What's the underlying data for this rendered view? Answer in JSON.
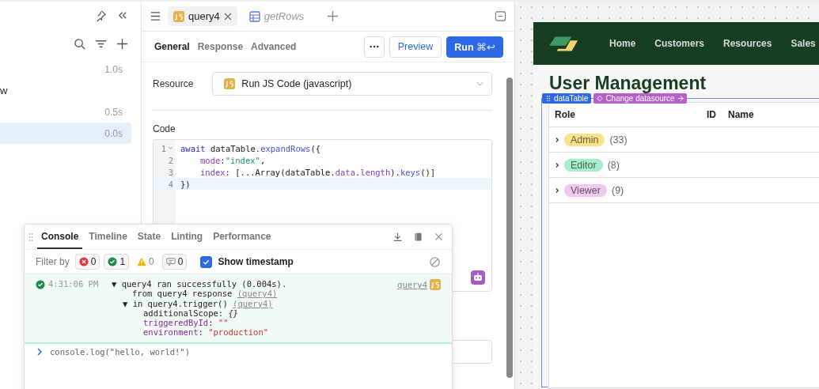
{
  "sidebar": {
    "items": [
      {
        "time": "1.0s",
        "selected": false
      },
      {
        "label": "w",
        "selected": false
      },
      {
        "time": "0.5s",
        "selected": false
      },
      {
        "time": "0.0s",
        "selected": true
      }
    ]
  },
  "editor_tabs": [
    {
      "label": "query4",
      "kind": "js",
      "selected": true,
      "preview": false
    },
    {
      "label": "getRows",
      "kind": "table",
      "selected": false,
      "preview": true
    }
  ],
  "query_tabs": [
    {
      "label": "General",
      "selected": true
    },
    {
      "label": "Response",
      "selected": false
    },
    {
      "label": "Advanced",
      "selected": false
    }
  ],
  "buttons": {
    "preview": "Preview",
    "run": "Run",
    "run_shortcut": "⌘↩"
  },
  "resource": {
    "label": "Resource",
    "value": "Run JS Code (javascript)"
  },
  "code": {
    "label": "Code",
    "lines": [
      {
        "number": "1",
        "foldable": true,
        "highlighted": false,
        "indented": false,
        "tokens": [
          {
            "kind": "keyword",
            "text": "await"
          },
          {
            "kind": "plain",
            "text": " dataTable."
          },
          {
            "kind": "method",
            "text": "expandRows"
          },
          {
            "kind": "plain",
            "text": "({"
          }
        ]
      },
      {
        "number": "2",
        "foldable": false,
        "highlighted": false,
        "indented": true,
        "tokens": [
          {
            "kind": "prop",
            "text": "mode"
          },
          {
            "kind": "plain",
            "text": ":"
          },
          {
            "kind": "string",
            "text": "\"index\""
          },
          {
            "kind": "plain",
            "text": ","
          }
        ]
      },
      {
        "number": "3",
        "foldable": false,
        "highlighted": false,
        "indented": true,
        "tokens": [
          {
            "kind": "prop",
            "text": "index"
          },
          {
            "kind": "plain",
            "text": ": [...Array(dataTable."
          },
          {
            "kind": "prop",
            "text": "data"
          },
          {
            "kind": "plain",
            "text": "."
          },
          {
            "kind": "prop",
            "text": "length"
          },
          {
            "kind": "plain",
            "text": ")."
          },
          {
            "kind": "method",
            "text": "keys"
          },
          {
            "kind": "plain",
            "text": "()]"
          }
        ]
      },
      {
        "number": "4",
        "foldable": false,
        "highlighted": true,
        "indented": false,
        "tokens": [
          {
            "kind": "plain",
            "text": "})"
          }
        ]
      }
    ]
  },
  "console": {
    "tabs": [
      {
        "label": "Console",
        "selected": true
      },
      {
        "label": "Timeline",
        "selected": false
      },
      {
        "label": "State",
        "selected": false
      },
      {
        "label": "Linting",
        "selected": false
      },
      {
        "label": "Performance",
        "selected": false
      }
    ],
    "filter": {
      "label": "Filter by",
      "chips": [
        {
          "kind": "error",
          "count": "0"
        },
        {
          "kind": "success",
          "count": "1"
        },
        {
          "kind": "warning",
          "count": "0"
        },
        {
          "kind": "message",
          "count": "0"
        }
      ]
    },
    "show_timestamp": {
      "label": "Show timestamp",
      "checked": true
    },
    "entries": [
      {
        "time": "4:31:06 PM",
        "source": "query4",
        "lines": [
          {
            "segments": [
              {
                "kind": "text",
                "text": "▼ query4 ran successfully (0.004s)."
              }
            ],
            "children": [
              {
                "segments": [
                  {
                    "kind": "text",
                    "text": "from query4 response "
                  },
                  {
                    "kind": "link",
                    "text": "(query4)"
                  }
                ]
              },
              {
                "segments": [
                  {
                    "kind": "text",
                    "text": "▼ in query4.trigger() "
                  },
                  {
                    "kind": "link",
                    "text": "(query4)"
                  }
                ],
                "children": [
                  {
                    "segments": [
                      {
                        "kind": "text",
                        "text": "additionalScope: "
                      },
                      {
                        "kind": "italic",
                        "text": "{}"
                      }
                    ]
                  },
                  {
                    "segments": [
                      {
                        "kind": "key",
                        "text": "triggeredById"
                      },
                      {
                        "kind": "text",
                        "text": ": "
                      },
                      {
                        "kind": "string",
                        "text": "\"\""
                      }
                    ]
                  },
                  {
                    "segments": [
                      {
                        "kind": "key",
                        "text": "environment"
                      },
                      {
                        "kind": "text",
                        "text": ": "
                      },
                      {
                        "kind": "string",
                        "text": "\"production\""
                      }
                    ]
                  }
                ]
              }
            ]
          }
        ]
      }
    ],
    "input": {
      "value": "console.log(\"hello, world!\")"
    }
  },
  "app": {
    "nav": [
      "Home",
      "Customers",
      "Resources",
      "Sales"
    ],
    "title": "User Management",
    "component_labels": [
      {
        "kind": "name",
        "label": "dataTable"
      },
      {
        "kind": "action",
        "label": "Change datasource"
      }
    ],
    "table": {
      "columns": [
        "Role",
        "ID",
        "Name"
      ],
      "rows": [
        {
          "role": "Admin",
          "count": "(33)",
          "color": "#fbe38a"
        },
        {
          "role": "Editor",
          "count": "(8)",
          "color": "#a7efcc"
        },
        {
          "role": "Viewer",
          "count": "(9)",
          "color": "#efc9f0"
        }
      ]
    }
  }
}
